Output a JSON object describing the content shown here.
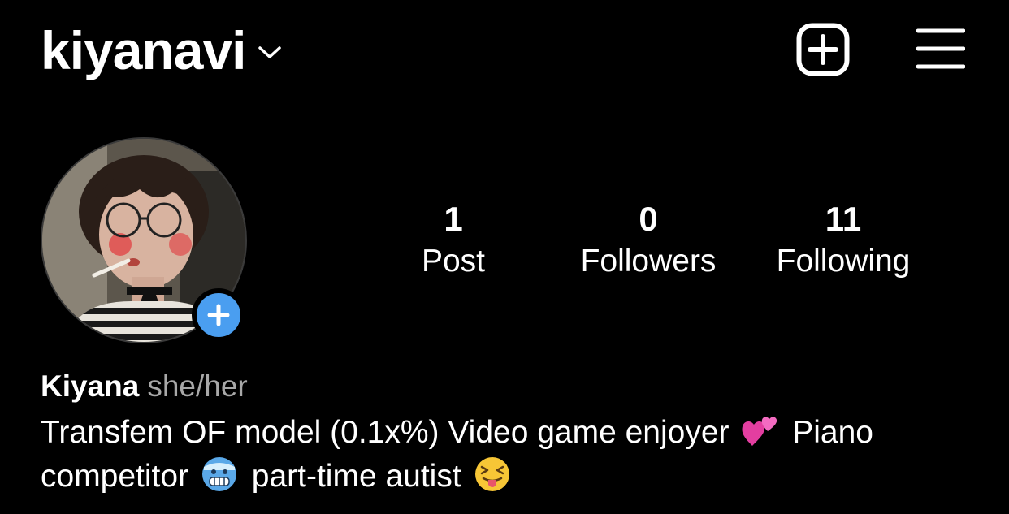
{
  "header": {
    "username": "kiyanavi",
    "chevron_icon": "chevron-down-icon",
    "new_post_icon": "plus-square-icon",
    "menu_icon": "hamburger-menu-icon"
  },
  "profile": {
    "avatar_icon": "profile-photo",
    "add_story_icon": "plus-icon",
    "add_story_color": "#4a9ef0"
  },
  "stats": {
    "posts_count": "1",
    "posts_label": "Post",
    "followers_count": "0",
    "followers_label": "Followers",
    "following_count": "11",
    "following_label": "Following"
  },
  "bio": {
    "display_name": "Kiyana",
    "pronouns": "she/her",
    "line1_text": "Transfem OF model (0.1x%) Video game enjoyer",
    "line1_emoji": "two-hearts-emoji",
    "line1_tail": "Piano",
    "line2_text": "competitor",
    "line2_emoji": "cold-face-emoji",
    "line2_mid": "part-time autist",
    "line2_end_emoji": "squinting-tongue-face-emoji"
  }
}
